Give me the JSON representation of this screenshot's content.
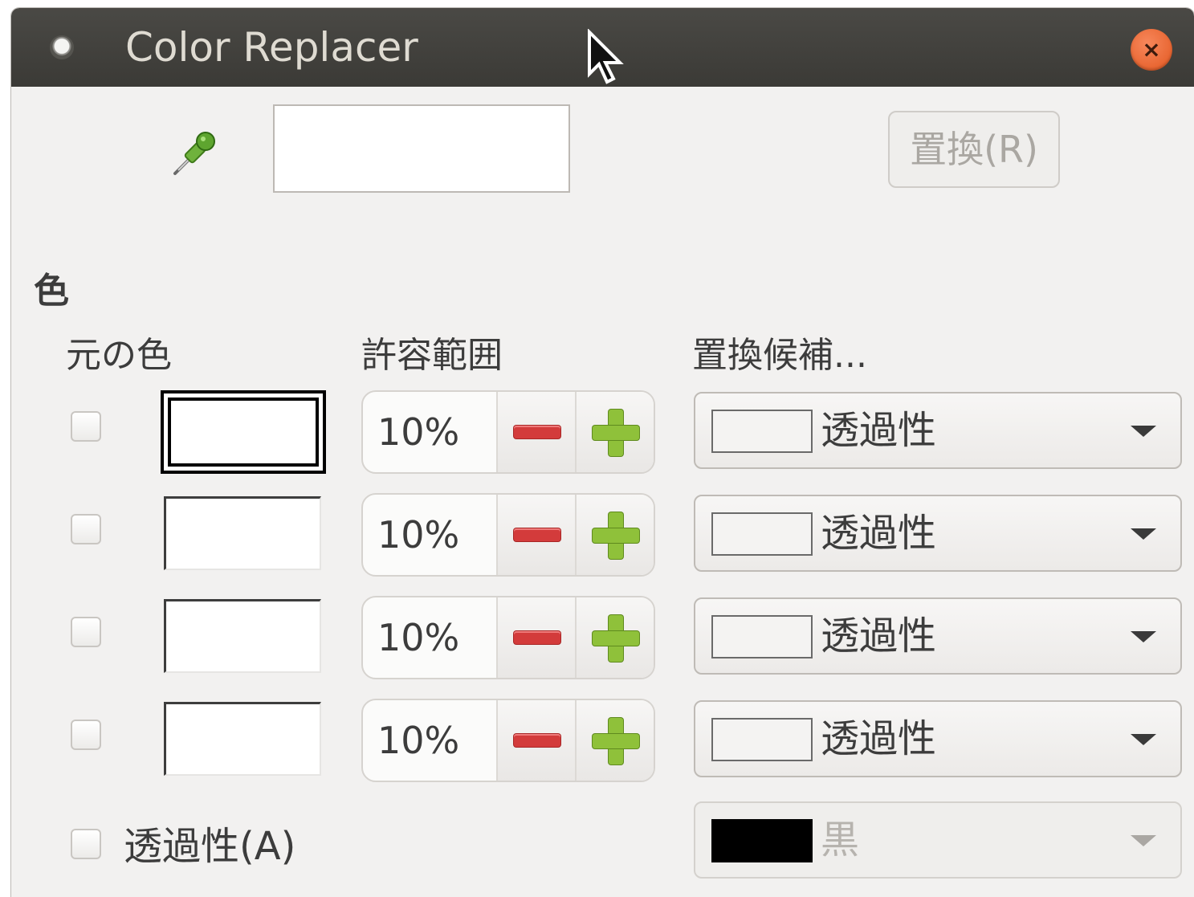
{
  "window": {
    "title": "Color Replacer",
    "close_label": "×"
  },
  "toolbar": {
    "eyedropper_icon": "eyedropper-icon",
    "picked_color": "",
    "replace_button": "置換(R)"
  },
  "section": {
    "heading": "色",
    "col_source": "元の色",
    "col_tolerance": "許容範囲",
    "col_candidate": "置換候補..."
  },
  "rows": [
    {
      "checked": false,
      "source_color": "#ffffff",
      "selected": true,
      "tolerance": "10%",
      "candidate": "透過性"
    },
    {
      "checked": false,
      "source_color": "#ffffff",
      "selected": false,
      "tolerance": "10%",
      "candidate": "透過性"
    },
    {
      "checked": false,
      "source_color": "#ffffff",
      "selected": false,
      "tolerance": "10%",
      "candidate": "透過性"
    },
    {
      "checked": false,
      "source_color": "#ffffff",
      "selected": false,
      "tolerance": "10%",
      "candidate": "透過性"
    }
  ],
  "alpha": {
    "checked": false,
    "label": "透過性(A)",
    "color_label": "黒",
    "color": "#000000",
    "enabled": false
  },
  "colors": {
    "titlebar": "#3f3e3a",
    "close_button": "#e95420",
    "background": "#f2f1f0",
    "minus": "#d33b3b",
    "plus": "#8fc13a"
  }
}
